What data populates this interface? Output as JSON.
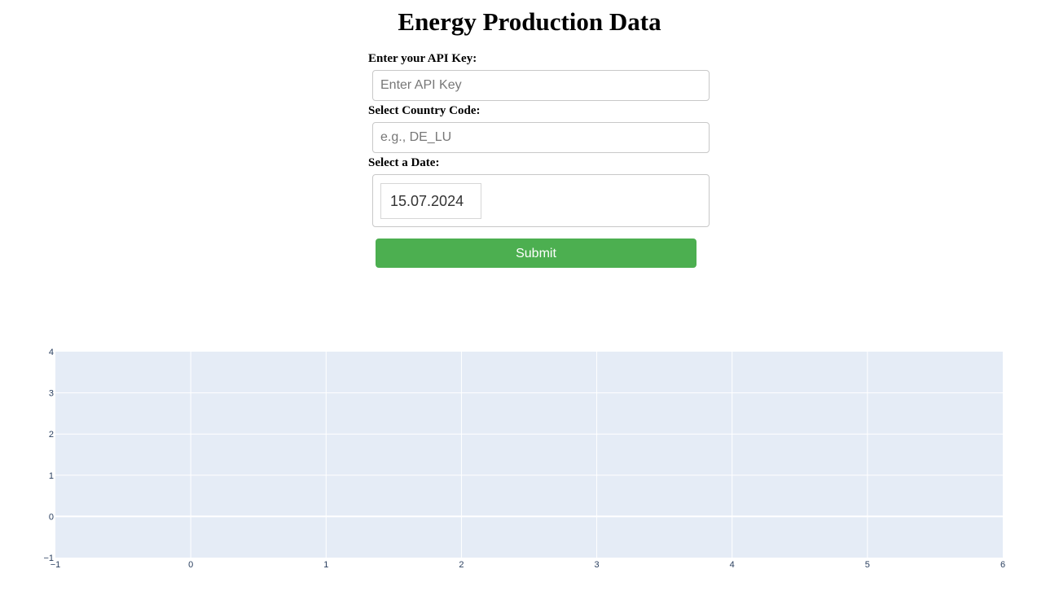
{
  "page": {
    "title": "Energy Production Data"
  },
  "form": {
    "api_key": {
      "label": "Enter your API Key:",
      "value": "",
      "placeholder": "Enter API Key"
    },
    "country_code": {
      "label": "Select Country Code:",
      "value": "",
      "placeholder": "e.g., DE_LU"
    },
    "date": {
      "label": "Select a Date:",
      "value": "15.07.2024"
    },
    "submit_label": "Submit",
    "submit_color": "#4caf50"
  },
  "chart_data": {
    "type": "line",
    "series": [],
    "xlim": [
      -1,
      6
    ],
    "ylim": [
      -1,
      4
    ],
    "x_ticks": [
      "−1",
      "0",
      "1",
      "2",
      "3",
      "4",
      "5",
      "6"
    ],
    "y_ticks": [
      "−1",
      "0",
      "1",
      "2",
      "3",
      "4"
    ],
    "grid": true,
    "plot_background": "#e5ecf6",
    "grid_color": "#ffffff",
    "tick_color": "#2a3f5f"
  }
}
